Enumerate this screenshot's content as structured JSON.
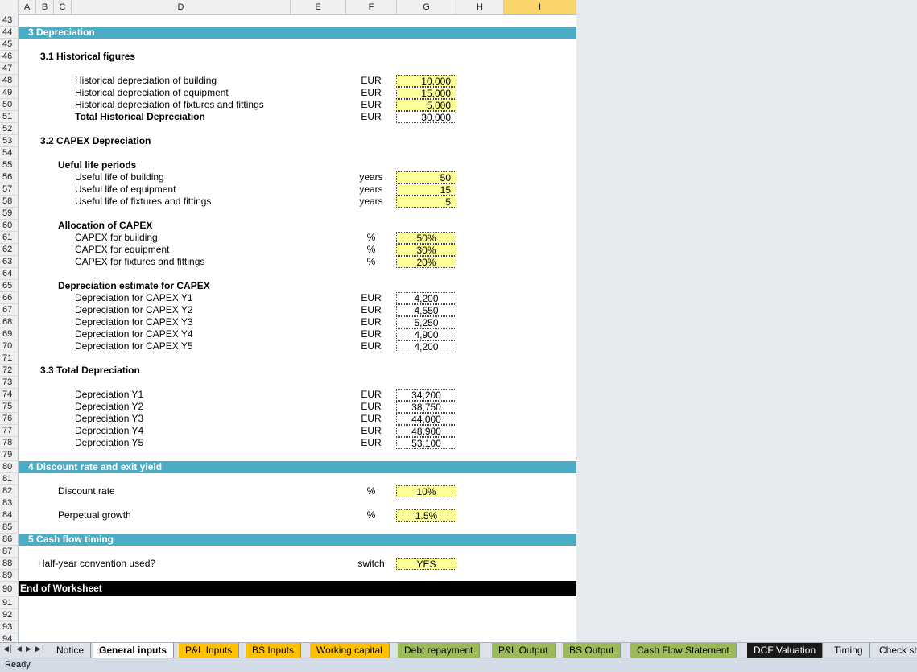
{
  "columns": [
    "A",
    "B",
    "C",
    "D",
    "E",
    "F",
    "G",
    "H",
    "I"
  ],
  "rows": [
    "43",
    "44",
    "45",
    "46",
    "47",
    "48",
    "49",
    "50",
    "51",
    "52",
    "53",
    "54",
    "55",
    "56",
    "57",
    "58",
    "59",
    "60",
    "61",
    "62",
    "63",
    "64",
    "65",
    "66",
    "67",
    "68",
    "69",
    "70",
    "71",
    "72",
    "73",
    "74",
    "75",
    "76",
    "77",
    "78",
    "79",
    "80",
    "81",
    "82",
    "83",
    "84",
    "85",
    "86",
    "87",
    "88",
    "89",
    "90",
    "91",
    "92",
    "93",
    "94"
  ],
  "sections": {
    "depreciation": "3  Depreciation",
    "discount": "4  Discount rate and exit yield",
    "cashflow": "5  Cash flow timing",
    "end": "End of Worksheet"
  },
  "historical": {
    "title": "3.1  Historical figures",
    "items": [
      {
        "label": "Historical depreciation of building",
        "unit": "EUR",
        "value": "10,000"
      },
      {
        "label": "Historical depreciation of equipment",
        "unit": "EUR",
        "value": "15,000"
      },
      {
        "label": "Historical depreciation of fixtures and fittings",
        "unit": "EUR",
        "value": "5,000"
      },
      {
        "label": "Total Historical Depreciation",
        "unit": "EUR",
        "value": "30,000"
      }
    ]
  },
  "capex": {
    "title": "3.2  CAPEX Depreciation",
    "useful_life_title": "Ueful life periods",
    "useful_life": [
      {
        "label": "Useful life of building",
        "unit": "years",
        "value": "50"
      },
      {
        "label": "Useful life of equipment",
        "unit": "years",
        "value": "15"
      },
      {
        "label": "Useful life of fixtures and fittings",
        "unit": "years",
        "value": "5"
      }
    ],
    "allocation_title": "Allocation of CAPEX",
    "allocation": [
      {
        "label": "CAPEX for building",
        "unit": "%",
        "value": "50%"
      },
      {
        "label": "CAPEX for equipment",
        "unit": "%",
        "value": "30%"
      },
      {
        "label": "CAPEX for fixtures and fittings",
        "unit": "%",
        "value": "20%"
      }
    ],
    "estimate_title": "Depreciation estimate for CAPEX",
    "estimate": [
      {
        "label": "Depreciation for CAPEX Y1",
        "unit": "EUR",
        "value": "4,200"
      },
      {
        "label": "Depreciation for CAPEX Y2",
        "unit": "EUR",
        "value": "4,550"
      },
      {
        "label": "Depreciation for CAPEX Y3",
        "unit": "EUR",
        "value": "5,250"
      },
      {
        "label": "Depreciation for CAPEX Y4",
        "unit": "EUR",
        "value": "4,900"
      },
      {
        "label": "Depreciation for CAPEX Y5",
        "unit": "EUR",
        "value": "4,200"
      }
    ]
  },
  "total": {
    "title": "3.3  Total Depreciation",
    "items": [
      {
        "label": "Depreciation Y1",
        "unit": "EUR",
        "value": "34,200"
      },
      {
        "label": "Depreciation Y2",
        "unit": "EUR",
        "value": "38,750"
      },
      {
        "label": "Depreciation Y3",
        "unit": "EUR",
        "value": "44,000"
      },
      {
        "label": "Depreciation Y4",
        "unit": "EUR",
        "value": "48,900"
      },
      {
        "label": "Depreciation Y5",
        "unit": "EUR",
        "value": "53,100"
      }
    ]
  },
  "discount": {
    "rate": {
      "label": "Discount rate",
      "unit": "%",
      "value": "10%"
    },
    "growth": {
      "label": "Perpetual growth",
      "unit": "%",
      "value": "1.5%"
    }
  },
  "timing": {
    "label": "Half-year convention used?",
    "unit": "switch",
    "value": "YES"
  },
  "tabs": [
    "Notice",
    "General inputs",
    "P&L Inputs",
    "BS Inputs",
    "Working capital",
    "Debt repayment",
    "P&L Output",
    "BS Output",
    "Cash Flow Statement",
    "DCF Valuation",
    "Timing",
    "Check sh"
  ],
  "tab_colors": {
    "yellow": "#ffc000",
    "green": "#9bbb59",
    "black": "#1a1a1a"
  },
  "status": "Ready"
}
